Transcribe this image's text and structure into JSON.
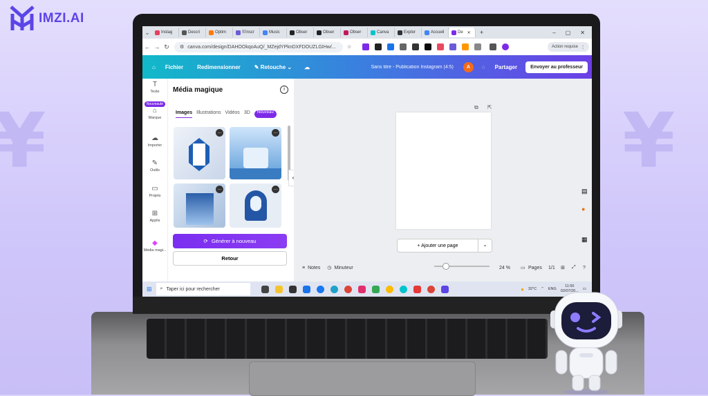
{
  "brand": {
    "name": "IMZI.AI",
    "accent": "#5b45e6"
  },
  "browser": {
    "tabs": [
      {
        "label": "Instag",
        "color": "#e4405f"
      },
      {
        "label": "Descri",
        "color": "#555"
      },
      {
        "label": "Optim",
        "color": "#ff7a00"
      },
      {
        "label": "S'inscr",
        "color": "#6b5bd6"
      },
      {
        "label": "Music",
        "color": "#4285f4"
      },
      {
        "label": "Obser",
        "color": "#222"
      },
      {
        "label": "Obser",
        "color": "#222"
      },
      {
        "label": "Obser",
        "color": "#c2185b"
      },
      {
        "label": "Canva",
        "color": "#00c4cc"
      },
      {
        "label": "Explor",
        "color": "#333"
      },
      {
        "label": "Accueil",
        "color": "#4285f4"
      },
      {
        "label": "De",
        "color": "#7d2ae8"
      }
    ],
    "url": "canva.com/design/DAHOOkqoAuQ/_MZejdYPknDXFDOUZLGIHw/...",
    "action_label": "Action requise"
  },
  "canva": {
    "menu": {
      "file": "Fichier",
      "resize": "Redimensionner",
      "edit": "Retouche"
    },
    "doc_title": "Sans titre - Publication Instagram (4:5)",
    "avatar_letter": "A",
    "share": "Partager",
    "send_teacher": "Envoyer au professeur",
    "rail": [
      {
        "label": "Texte",
        "icon": "T"
      },
      {
        "label": "Marque",
        "icon": "⌂",
        "badge": "Nouveauté"
      },
      {
        "label": "Importer",
        "icon": "☁"
      },
      {
        "label": "Outils",
        "icon": "✎"
      },
      {
        "label": "Projets",
        "icon": "▭"
      },
      {
        "label": "Applis",
        "icon": "⊞"
      },
      {
        "label": "Média magi...",
        "icon": "◆"
      }
    ],
    "panel": {
      "title": "Média magique",
      "tabs": [
        "Images",
        "Illustrations",
        "Vidéos",
        "3D"
      ],
      "new_badge": "Nouveau",
      "regenerate": "Générer à nouveau",
      "back": "Retour"
    },
    "canvas": {
      "add_page": "+ Ajouter une page",
      "notes": "Notes",
      "timer": "Minuteur",
      "zoom": "24 %",
      "pages": "Pages",
      "page_count": "1/1"
    }
  },
  "taskbar": {
    "search_placeholder": "Taper ici pour rechercher",
    "weather": "32°C",
    "lang": "ENG",
    "time": "11:50",
    "date": "02/07/20..."
  }
}
